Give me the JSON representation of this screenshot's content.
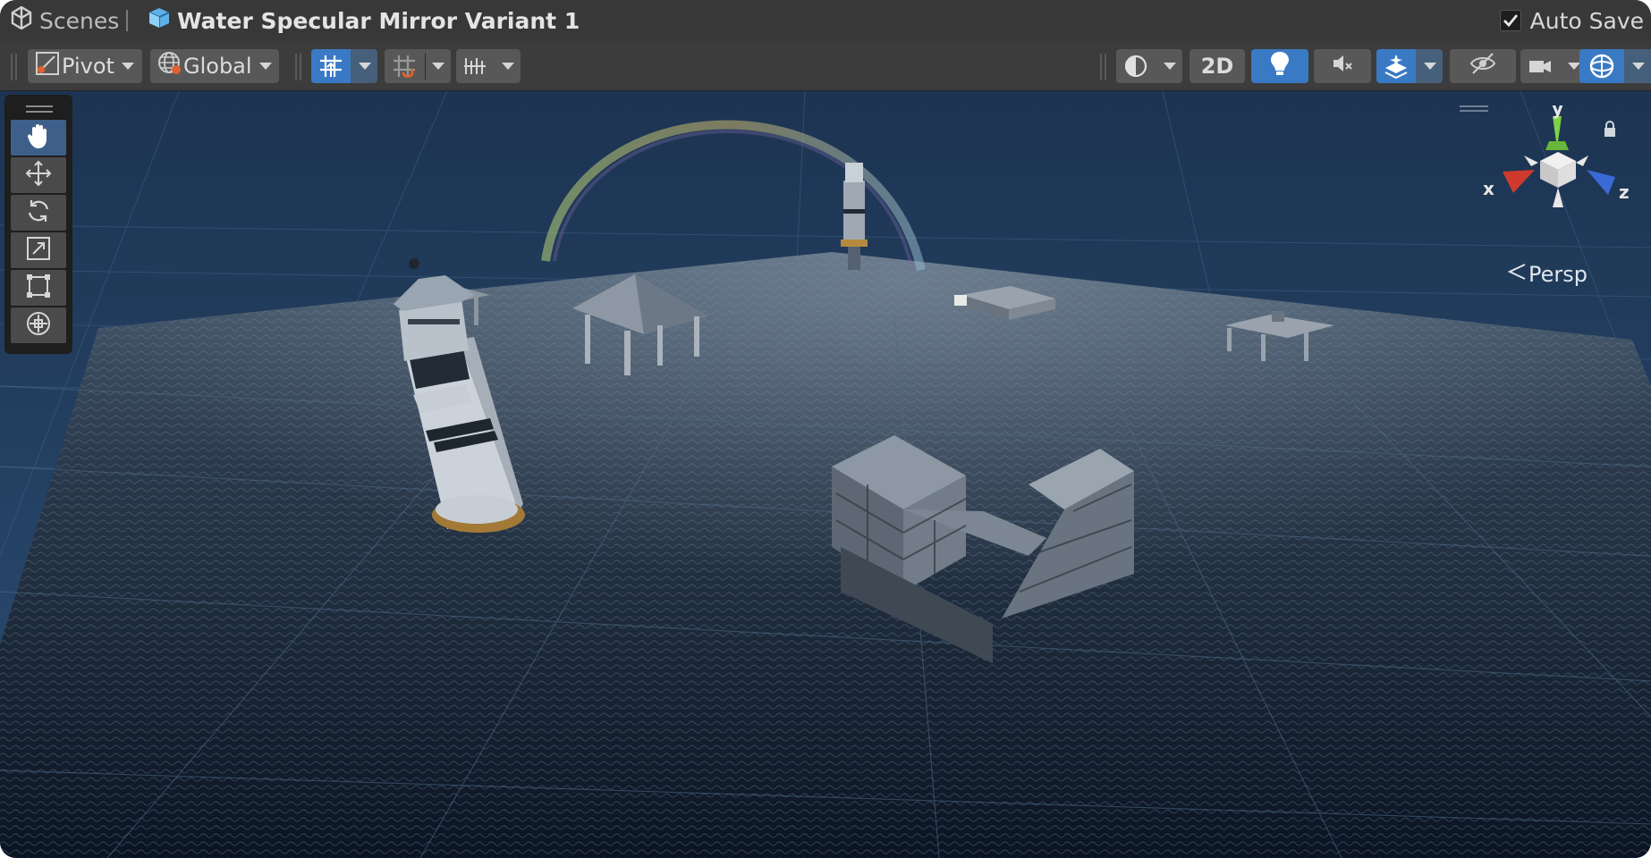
{
  "breadcrumb": {
    "root_label": "Scenes",
    "scene_label": "Water Specular Mirror Variant 1"
  },
  "auto_save": {
    "label": "Auto Save",
    "checked": true
  },
  "toolbar": {
    "pivot_label": "Pivot",
    "global_label": "Global",
    "mode_2d_label": "2D"
  },
  "gizmo": {
    "y_label": "y",
    "x_label": "x",
    "z_label": "z"
  },
  "projection_label": "Persp",
  "colors": {
    "toolbar_bg": "#3c3c3c",
    "button_bg": "#585858",
    "active_blue": "#3a7ac4",
    "sky": "#1f3550",
    "water": "#0d1826"
  }
}
